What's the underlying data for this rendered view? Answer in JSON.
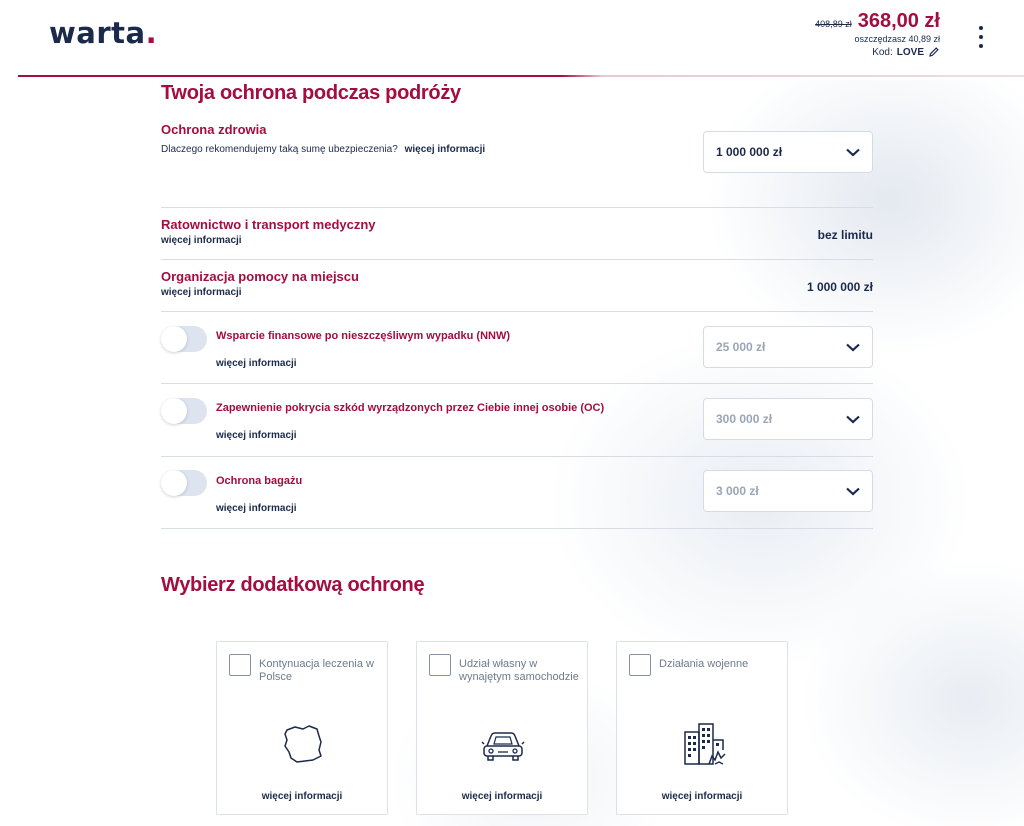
{
  "header": {
    "logo_text": "warta",
    "logo_dot": ".",
    "old_price": "408,89 zł",
    "new_price": "368,00 zł",
    "savings": "oszczędzasz 40,89 zł",
    "promo_label": "Kod:",
    "promo_code": "LOVE"
  },
  "protection": {
    "title": "Twoja ochrona podczas podróży",
    "health": {
      "title": "Ochrona zdrowia",
      "desc": "Dlaczego rekomendujemy taką sumę ubezpieczenia?",
      "link": "więcej informacji",
      "value": "1 000 000 zł"
    },
    "rescue": {
      "title": "Ratownictwo i transport medyczny",
      "link": "więcej informacji",
      "value": "bez limitu"
    },
    "assistance": {
      "title": "Organizacja pomocy na miejscu",
      "link": "więcej informacji",
      "value": "1 000 000 zł"
    },
    "nnw": {
      "title": "Wsparcie finansowe po nieszczęśliwym wypadku (NNW)",
      "link": "więcej informacji",
      "value": "25 000 zł"
    },
    "oc": {
      "title": "Zapewnienie pokrycia szkód wyrządzonych przez Ciebie innej osobie (OC)",
      "link": "więcej informacji",
      "value": "300 000 zł"
    },
    "luggage": {
      "title": "Ochrona bagażu",
      "link": "więcej informacji",
      "value": "3 000 zł"
    }
  },
  "additional": {
    "title": "Wybierz dodatkową ochronę",
    "cards": [
      {
        "label": "Kontynuacja leczenia w Polsce",
        "icon": "poland-map-icon",
        "link": "więcej informacji"
      },
      {
        "label": "Udział własny w wynajętym samochodzie",
        "icon": "car-icon",
        "link": "więcej informacji"
      },
      {
        "label": "Działania wojenne",
        "icon": "damaged-building-icon",
        "link": "więcej informacji"
      }
    ]
  },
  "colors": {
    "brand": "#a30d3f",
    "text": "#1b2a4a"
  }
}
